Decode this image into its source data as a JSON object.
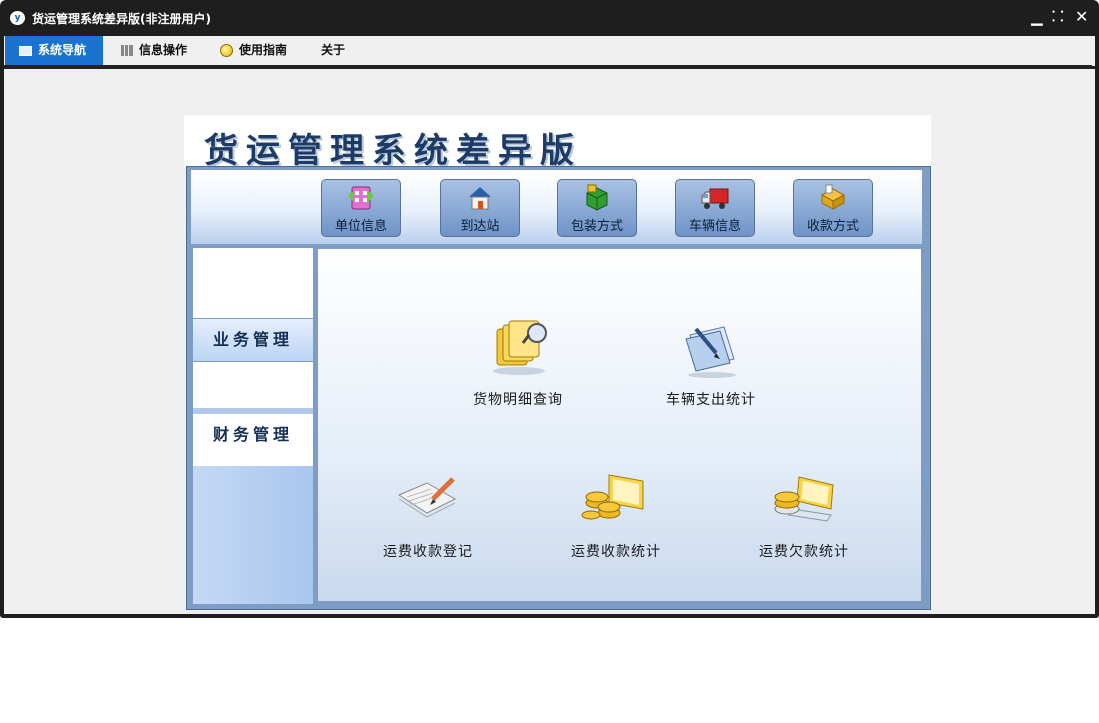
{
  "window": {
    "title": "货运管理系统差异版(非注册用户)",
    "app_icon": "y",
    "controls": {
      "minimize": "▁",
      "restore": "⸬",
      "close": "✕"
    }
  },
  "menu": {
    "tabs": [
      {
        "label": "系统导航",
        "icon": "monitor-icon",
        "active": true
      },
      {
        "label": "信息操作",
        "icon": "grid-icon",
        "active": false
      },
      {
        "label": "使用指南",
        "icon": "bulb-icon",
        "active": false
      },
      {
        "label": "关于",
        "icon": "",
        "active": false
      }
    ]
  },
  "banner": {
    "title": "货运管理系统差异版"
  },
  "toolbar": {
    "buttons": [
      {
        "label": "单位信息",
        "icon": "building-icon"
      },
      {
        "label": "到达站",
        "icon": "house-icon"
      },
      {
        "label": "包装方式",
        "icon": "package-icon"
      },
      {
        "label": "车辆信息",
        "icon": "truck-icon"
      },
      {
        "label": "收款方式",
        "icon": "payment-icon"
      }
    ]
  },
  "sidebar": {
    "items": [
      {
        "label": "业务管理",
        "selected": false
      },
      {
        "label": "财务管理",
        "selected": true
      }
    ]
  },
  "features": [
    {
      "label": "货物明细查询",
      "icon": "folder-search-icon"
    },
    {
      "label": "车辆支出统计",
      "icon": "document-pen-icon"
    },
    {
      "label": "运费收款登记",
      "icon": "register-pen-icon"
    },
    {
      "label": "运费收款统计",
      "icon": "coins-laptop-icon"
    },
    {
      "label": "运费欠款统计",
      "icon": "coins-stack-icon"
    }
  ],
  "colors": {
    "title_bar": "#1e1e1e",
    "active_tab": "#1b73d0",
    "banner_text": "#1e3b66",
    "panel_frame": "#7f9cc5"
  }
}
